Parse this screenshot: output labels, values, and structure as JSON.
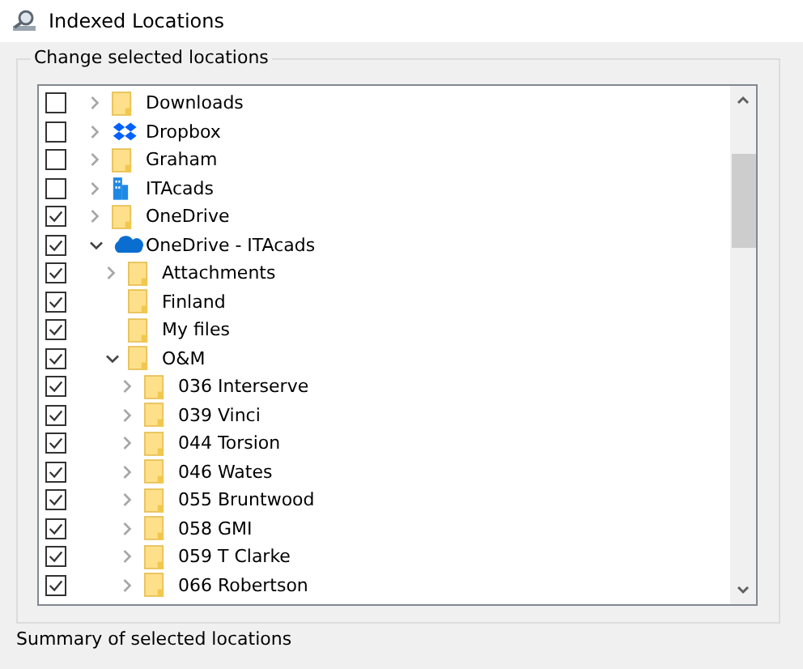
{
  "window": {
    "title": "Indexed Locations"
  },
  "locations": {
    "label": "Change selected locations",
    "items": [
      {
        "name": "Downloads",
        "kind": "folder",
        "checked": false,
        "expandable": true,
        "expanded": false
      },
      {
        "name": "Dropbox",
        "kind": "dropbox",
        "checked": false,
        "expandable": true,
        "expanded": false
      },
      {
        "name": "Graham",
        "kind": "folder",
        "checked": false,
        "expandable": true,
        "expanded": false
      },
      {
        "name": "ITAcads",
        "kind": "building",
        "checked": false,
        "expandable": true,
        "expanded": false
      },
      {
        "name": "OneDrive",
        "kind": "folder",
        "checked": true,
        "expandable": true,
        "expanded": false
      },
      {
        "name": "OneDrive - ITAcads",
        "kind": "cloud",
        "checked": true,
        "expandable": true,
        "expanded": true,
        "children": [
          {
            "name": "Attachments",
            "kind": "folder",
            "checked": true,
            "expandable": true,
            "expanded": false
          },
          {
            "name": "Finland",
            "kind": "folder",
            "checked": true,
            "expandable": false
          },
          {
            "name": "My files",
            "kind": "folder",
            "checked": true,
            "expandable": false
          },
          {
            "name": "O&M",
            "kind": "folder",
            "checked": true,
            "expandable": true,
            "expanded": true,
            "children": [
              {
                "name": "036 Interserve",
                "kind": "folder",
                "checked": true,
                "expandable": true,
                "expanded": false
              },
              {
                "name": "039 Vinci",
                "kind": "folder",
                "checked": true,
                "expandable": true,
                "expanded": false
              },
              {
                "name": "044 Torsion",
                "kind": "folder",
                "checked": true,
                "expandable": true,
                "expanded": false
              },
              {
                "name": "046 Wates",
                "kind": "folder",
                "checked": true,
                "expandable": true,
                "expanded": false
              },
              {
                "name": "055 Bruntwood",
                "kind": "folder",
                "checked": true,
                "expandable": true,
                "expanded": false
              },
              {
                "name": "058 GMI",
                "kind": "folder",
                "checked": true,
                "expandable": true,
                "expanded": false
              },
              {
                "name": "059 T Clarke",
                "kind": "folder",
                "checked": true,
                "expandable": true,
                "expanded": false
              },
              {
                "name": "066 Robertson",
                "kind": "folder",
                "checked": true,
                "expandable": true,
                "expanded": false
              }
            ]
          }
        ]
      }
    ]
  },
  "summary": {
    "label": "Summary of selected locations"
  }
}
